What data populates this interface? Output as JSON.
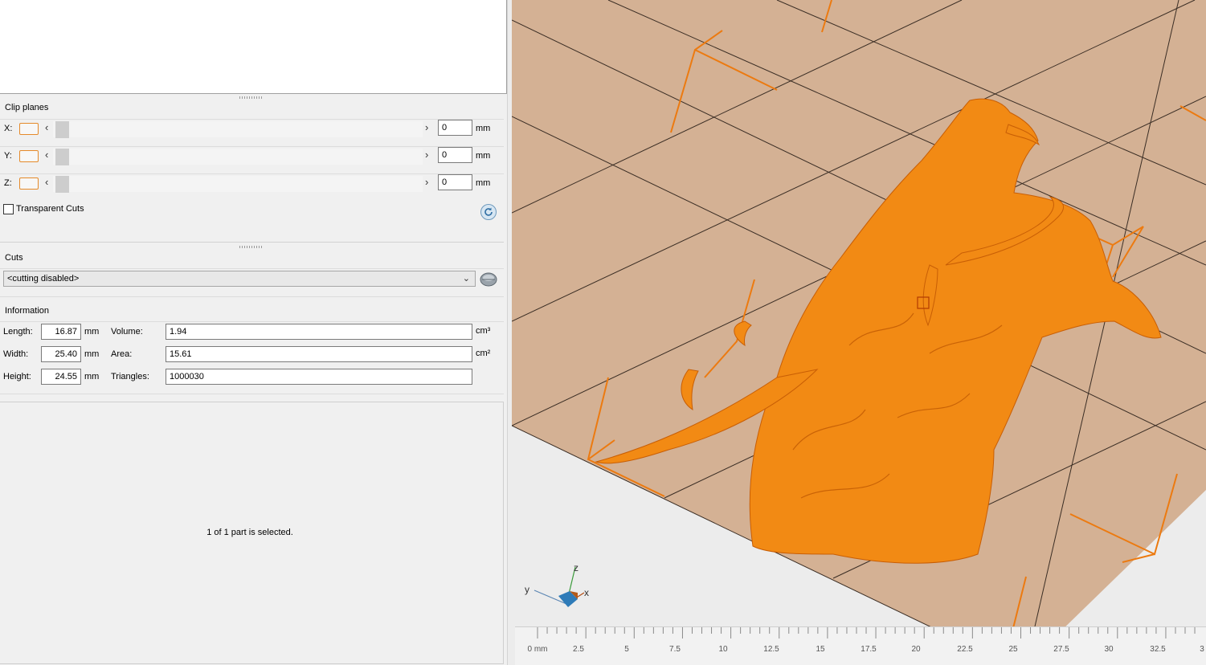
{
  "clip_planes": {
    "title": "Clip planes",
    "unit": "mm",
    "rows": [
      {
        "axis": "X:",
        "value": "0"
      },
      {
        "axis": "Y:",
        "value": "0"
      },
      {
        "axis": "Z:",
        "value": "0"
      }
    ],
    "transparent_cuts_label": "Transparent Cuts"
  },
  "cuts": {
    "title": "Cuts",
    "selected": "<cutting disabled>"
  },
  "information": {
    "title": "Information",
    "length_label": "Length:",
    "length": "16.87",
    "length_unit": "mm",
    "width_label": "Width:",
    "width": "25.40",
    "width_unit": "mm",
    "height_label": "Height:",
    "height": "24.55",
    "height_unit": "mm",
    "volume_label": "Volume:",
    "volume": "1.94",
    "volume_unit": "cm³",
    "area_label": "Area:",
    "area": "15.61",
    "area_unit": "cm²",
    "triangles_label": "Triangles:",
    "triangles": "1000030"
  },
  "status": {
    "selection": "1 of 1 part is selected."
  },
  "viewport": {
    "model_color": "#f28a14",
    "bed_color": "#d4b194",
    "axis_labels": {
      "x": "x",
      "y": "y",
      "z": "z"
    },
    "ruler_labels": [
      "0 mm",
      "2.5",
      "5",
      "7.5",
      "10",
      "12.5",
      "15",
      "17.5",
      "20",
      "22.5",
      "25",
      "27.5",
      "30",
      "32.5",
      "3"
    ]
  },
  "colors": {
    "accent": "#e58a2a",
    "panel_bg": "#f0f0f0"
  }
}
